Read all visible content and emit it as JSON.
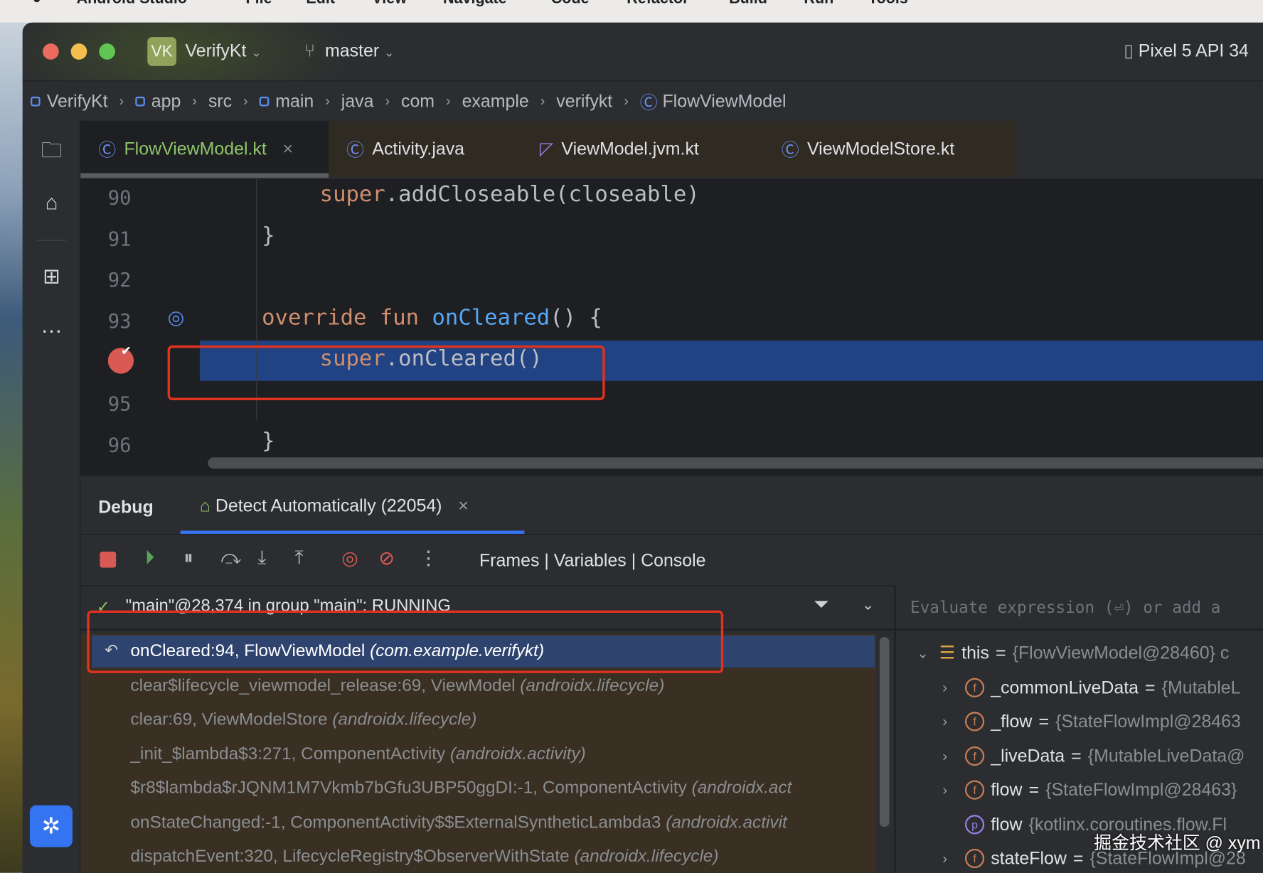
{
  "menubar": {
    "items": [
      "Android Studio",
      "File",
      "Edit",
      "View",
      "Navigate",
      "Code",
      "Refactor",
      "Build",
      "Run",
      "Tools"
    ]
  },
  "titlebar": {
    "project_badge": "VK",
    "project": "VerifyKt",
    "branch": "master",
    "device": "Pixel 5 API 34"
  },
  "breadcrumb": [
    "VerifyKt",
    "app",
    "src",
    "main",
    "java",
    "com",
    "example",
    "verifykt",
    "FlowViewModel"
  ],
  "tabs": [
    {
      "label": "FlowViewModel.kt",
      "active": true
    },
    {
      "label": "Activity.java"
    },
    {
      "label": "ViewModel.jvm.kt"
    },
    {
      "label": "ViewModelStore.kt"
    }
  ],
  "editor": {
    "lines": [
      {
        "n": "90",
        "kw": "super",
        "rest": ".addCloseable(closeable)"
      },
      {
        "n": "91",
        "rest": "}"
      },
      {
        "n": "92",
        "rest": ""
      },
      {
        "n": "93",
        "kw": "override fun ",
        "fn": "onCleared",
        "rest": "() {"
      },
      {
        "n": "94",
        "kw": "super",
        "rest": ".onCleared()",
        "breakpoint": true,
        "current": true
      },
      {
        "n": "95",
        "rest": ""
      },
      {
        "n": "96",
        "rest": "}"
      }
    ]
  },
  "debug": {
    "title": "Debug",
    "session": "Detect Automatically (22054)",
    "views": "Frames | Variables | Console",
    "thread": "\"main\"@28,374 in group \"main\": RUNNING",
    "eval_placeholder": "Evaluate expression (⏎) or add a",
    "frames": [
      {
        "m": "onCleared:94, FlowViewModel ",
        "p": "(com.example.verifykt)",
        "selected": true
      },
      {
        "m": "clear$lifecycle_viewmodel_release:69, ViewModel ",
        "p": "(androidx.lifecycle)"
      },
      {
        "m": "clear:69, ViewModelStore ",
        "p": "(androidx.lifecycle)"
      },
      {
        "m": "_init_$lambda$3:271, ComponentActivity ",
        "p": "(androidx.activity)"
      },
      {
        "m": "$r8$lambda$rJQNM1M7Vkmb7bGfu3UBP50ggDI:-1, ComponentActivity ",
        "p": "(androidx.act"
      },
      {
        "m": "onStateChanged:-1, ComponentActivity$$ExternalSyntheticLambda3 ",
        "p": "(androidx.activit"
      },
      {
        "m": "dispatchEvent:320, LifecycleRegistry$ObserverWithState ",
        "p": "(androidx.lifecycle)"
      }
    ],
    "variables": [
      {
        "name": "this",
        "val": "{FlowViewModel@28460} c",
        "icon": "object-icon",
        "expanded": true
      },
      {
        "name": "_commonLiveData",
        "val": "{MutableL",
        "icon": "field-icon"
      },
      {
        "name": "_flow",
        "val": "{StateFlowImpl@28463",
        "icon": "field-icon"
      },
      {
        "name": "_liveData",
        "val": "{MutableLiveData@",
        "icon": "field-icon"
      },
      {
        "name": "flow",
        "val": "{StateFlowImpl@28463}",
        "icon": "field-icon"
      },
      {
        "name": "flow",
        "val": "{kotlinx.coroutines.flow.Fl",
        "icon": "property-icon"
      },
      {
        "name": "stateFlow",
        "val": "{StateFlowImpl@28",
        "icon": "field-icon"
      }
    ]
  },
  "watermark": "掘金技术社区 @ xym",
  "colors": {
    "accent": "#3574f0",
    "selection": "#214283",
    "annotation": "#e0331f"
  }
}
